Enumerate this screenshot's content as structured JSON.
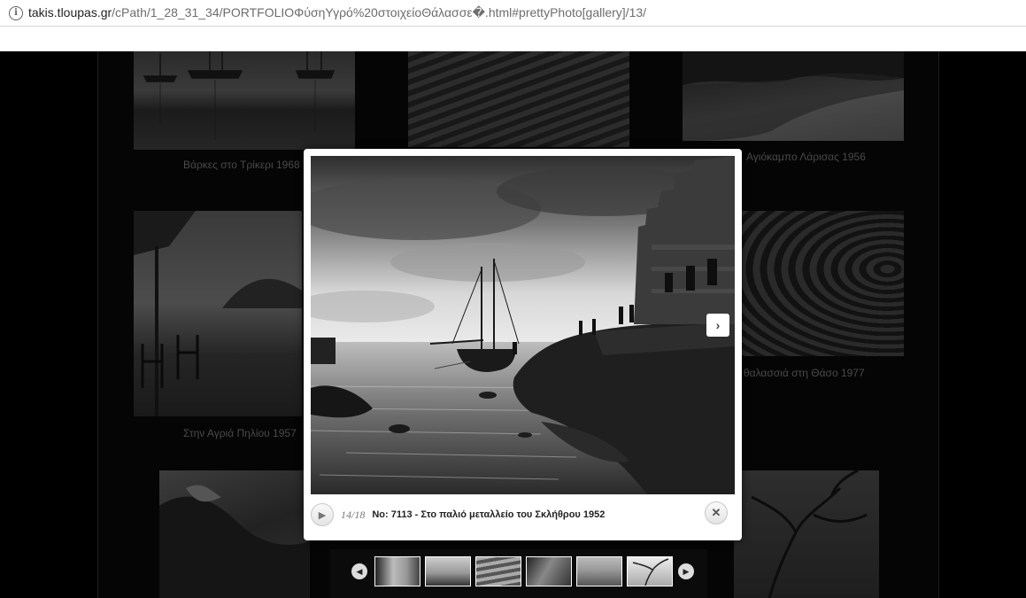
{
  "browser": {
    "url_host": "takis.tloupas.gr",
    "url_path": "/cPath/1_28_31_34/PORTFOLIOΦύσηΥγρό%20στοιχείοΘάλασσε�.html#prettyPhoto[gallery]/13/"
  },
  "gallery": {
    "captions": [
      "Βάρκες στο Τρίκερι 1968",
      "Αγιόκαμπο Λάρισας 1956",
      "Στην Αγριά Πηλίου 1957",
      "θαλασσιά στη Θάσο 1977"
    ]
  },
  "lightbox": {
    "counter": "14/18",
    "description": "No: 7113  -  Στο παλιό μεταλλείο του Σκλήθρου 1952",
    "play_icon": "play-icon",
    "close_icon": "close-icon",
    "next_icon": "chevron-right-icon"
  },
  "strip": {
    "prev_icon": "chevron-left-icon",
    "next_icon": "chevron-right-icon",
    "thumbnail_count": 6
  },
  "colors": {
    "overlay_bg": "#000000",
    "lightbox_bg": "#ffffff",
    "caption_text": "#4a4a4a"
  }
}
